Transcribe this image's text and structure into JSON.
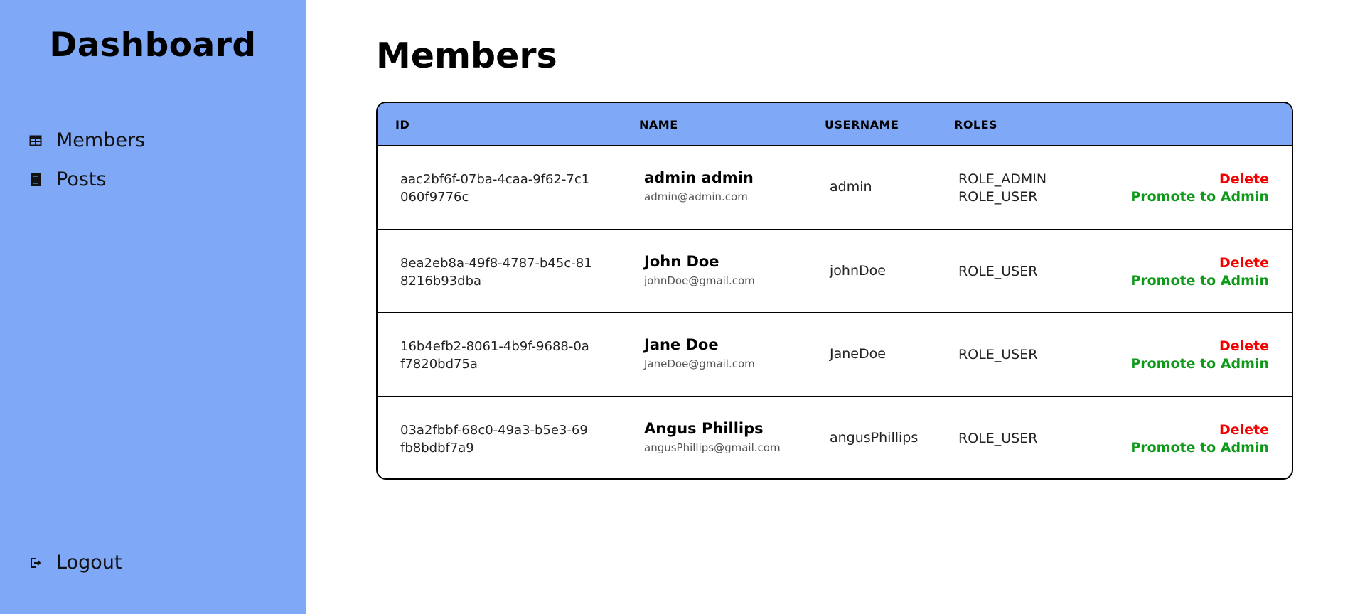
{
  "sidebar": {
    "brand": "Dashboard",
    "nav": [
      {
        "label": "Members",
        "icon": "table-icon"
      },
      {
        "label": "Posts",
        "icon": "document-icon"
      }
    ],
    "logout": {
      "label": "Logout",
      "icon": "logout-icon"
    }
  },
  "main": {
    "title": "Members",
    "table": {
      "headers": {
        "id": "ID",
        "name": "NAME",
        "username": "USERNAME",
        "roles": "ROLES"
      },
      "rows": [
        {
          "id": "aac2bf6f-07ba-4caa-9f62-7c1060f9776c",
          "name": "admin admin",
          "email": "admin@admin.com",
          "username": "admin",
          "roles": [
            "ROLE_ADMIN",
            "ROLE_USER"
          ],
          "delete": "Delete",
          "promote": "Promote to Admin"
        },
        {
          "id": "8ea2eb8a-49f8-4787-b45c-818216b93dba",
          "name": "John Doe",
          "email": "johnDoe@gmail.com",
          "username": "johnDoe",
          "roles": [
            "ROLE_USER"
          ],
          "delete": "Delete",
          "promote": "Promote to Admin"
        },
        {
          "id": "16b4efb2-8061-4b9f-9688-0af7820bd75a",
          "name": "Jane Doe",
          "email": "JaneDoe@gmail.com",
          "username": "JaneDoe",
          "roles": [
            "ROLE_USER"
          ],
          "delete": "Delete",
          "promote": "Promote to Admin"
        },
        {
          "id": "03a2fbbf-68c0-49a3-b5e3-69fb8bdbf7a9",
          "name": "Angus Phillips",
          "email": "angusPhillips@gmail.com",
          "username": "angusPhillips",
          "roles": [
            "ROLE_USER"
          ],
          "delete": "Delete",
          "promote": "Promote to Admin"
        }
      ]
    }
  },
  "colors": {
    "accent": "#7fa8f7",
    "delete": "#f50000",
    "promote": "#0f9a1a"
  }
}
